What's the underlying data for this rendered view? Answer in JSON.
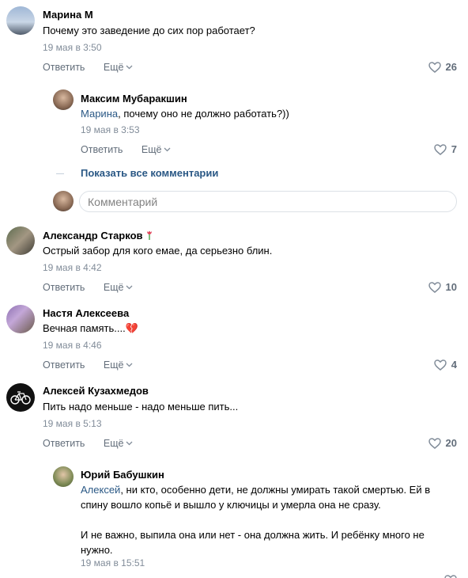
{
  "labels": {
    "reply": "Ответить",
    "more": "Ещё",
    "show_all": "Показать все комментарии",
    "comment_placeholder": "Комментарий"
  },
  "comments": [
    {
      "author": "Марина М",
      "text": "Почему это заведение до сих пор работает?",
      "date": "19 мая в 3:50",
      "likes": "26"
    },
    {
      "author": "Максим Мубаракшин",
      "mention": "Марина",
      "text": ", почему оно не должно работать?))",
      "date": "19 мая в 3:53",
      "likes": "7"
    },
    {
      "author": "Александр Старков",
      "text": "Острый забор для кого емае, да серьезно блин.",
      "date": "19 мая в 4:42",
      "likes": "10"
    },
    {
      "author": "Настя Алексеева",
      "text": "Вечная память....",
      "emoji": "💔",
      "date": "19 мая в 4:46",
      "likes": "4"
    },
    {
      "author": "Алексей Кузахмедов",
      "text": "Пить надо меньше - надо меньше пить...",
      "date": "19 мая в 5:13",
      "likes": "20"
    },
    {
      "author": "Юрий Бабушкин",
      "mention": "Алексей",
      "text_line1": ", ни кто, особенно дети, не должны умирать такой смертью. Ей в",
      "text_line2": "спину вошло копьё и вышло у ключицы и умерла она не сразу.",
      "text_line3": "И не важно, выпила она или нет - она должна жить. И ребёнку много не",
      "text_line4": "нужно.",
      "date": "19 мая в 15:51"
    }
  ],
  "colors": {
    "link": "#2a5885",
    "secondary": "#818c99",
    "action": "#626d7a"
  }
}
